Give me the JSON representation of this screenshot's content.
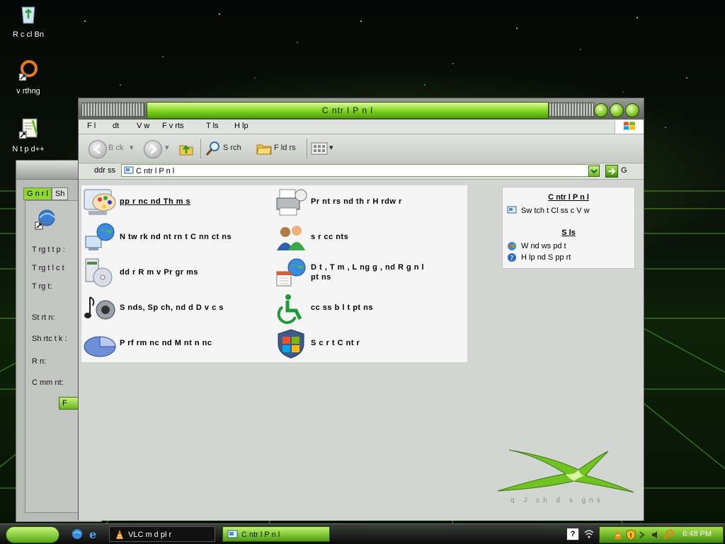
{
  "desktop": {
    "icons": [
      {
        "label": "R c cl  Bn"
      },
      {
        "label": "v rthng"
      },
      {
        "label": "N t p d++"
      }
    ]
  },
  "properties_window": {
    "tabs": [
      "G n r l",
      "Sh"
    ],
    "fields": [
      "T rg t t p :",
      "T rg t l c t",
      "T rg t:",
      "St rt  n:",
      "Sh rtc t k :",
      "R n:",
      "C mm nt:"
    ],
    "finish_button": "F"
  },
  "window": {
    "title": "C ntr l P n l",
    "menu": [
      "F l",
      "  dt",
      "V w",
      "F v rts",
      "T  ls",
      "H lp"
    ],
    "toolbar": {
      "back": "B ck",
      "search": "S   rch",
      "folders": "F ld rs"
    },
    "address": {
      "label": "  ddr ss",
      "value": "C ntr l P n l",
      "go": "G"
    },
    "categories": [
      {
        "label": "  pp  r nc    nd Th m s"
      },
      {
        "label": "Pr nt rs   nd   th r H rdw r"
      },
      {
        "label": "N tw rk   nd  nt rn t C nn ct  ns"
      },
      {
        "label": "  s r    cc  nts"
      },
      {
        "label": "  dd  r R m v  Pr gr ms"
      },
      {
        "label": "D t , T m , L ng   g ,   nd R g  n l"
      },
      {
        "label": "S  nds, Sp  ch,   nd      d   D v c s"
      },
      {
        "label": "  cc ss b l t     pt  ns"
      },
      {
        "label": "P rf rm nc    nd M  nt n nc"
      },
      {
        "label": "S c r t  C nt r"
      }
    ],
    "categories_second_line": "  pt  ns",
    "side_pane": {
      "section1_title": "C ntr l P n l",
      "switch": "Sw tch t  Cl ss c V  w",
      "section2_title": "S       ls",
      "links": [
        "W nd ws   pd t",
        "H lp  nd S pp rt"
      ]
    },
    "logo_text": "  q  J  ch     d s gns"
  },
  "taskbar": {
    "tasks": [
      "VLC m d   pl   r",
      "C ntr l P n l"
    ],
    "clock": "6:48 PM",
    "help": "?"
  }
}
